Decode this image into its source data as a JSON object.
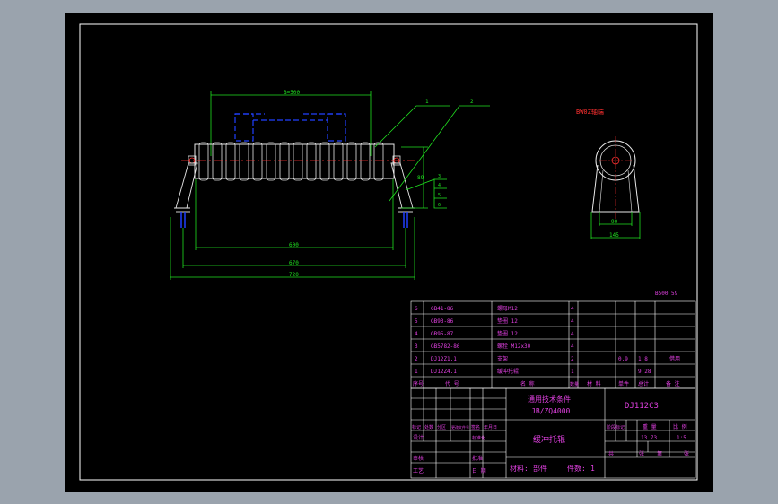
{
  "dimensions": {
    "front_b": "B=500",
    "dim_600": "600",
    "dim_670": "670",
    "dim_720": "720",
    "dim_89": "89",
    "side_90": "90",
    "side_145": "145",
    "side_title": "BW0Z轴端",
    "callout_1": "1",
    "callout_2": "2",
    "tab_3": "3",
    "tab_4": "4",
    "tab_5": "5",
    "tab_6": "6"
  },
  "spec_note": "B500  59",
  "parts": [
    {
      "no": "6",
      "code": "GB41-86",
      "name": "螺母M12",
      "qty": "4",
      "w1": "",
      "w2": "",
      "note": ""
    },
    {
      "no": "5",
      "code": "GB93-86",
      "name": "垫圈 12",
      "qty": "4",
      "w1": "",
      "w2": "",
      "note": ""
    },
    {
      "no": "4",
      "code": "GB95-87",
      "name": "垫圈 12",
      "qty": "4",
      "w1": "",
      "w2": "",
      "note": ""
    },
    {
      "no": "3",
      "code": "GB5782-86",
      "name": "螺栓 M12x30",
      "qty": "4",
      "w1": "",
      "w2": "",
      "note": ""
    },
    {
      "no": "2",
      "code": "DJ12Z1.1",
      "name": "支架",
      "qty": "2",
      "w1": "0.9",
      "w2": "1.8",
      "note": "借用"
    },
    {
      "no": "1",
      "code": "DJ12Z4.1",
      "name": "缓冲托辊",
      "qty": "1",
      "w1": "",
      "w2": "9.28",
      "note": ""
    }
  ],
  "parts_header": {
    "no": "序号",
    "code": "代 号",
    "name": "名 称",
    "qty": "数量",
    "material": "材 料",
    "single": "单件",
    "total": "总计",
    "weight": "重 量",
    "note": "备 注"
  },
  "title_block": {
    "standard_line1": "通用技术条件",
    "standard_line2": "JB/ZQ4000",
    "drawing_no": "DJ112C3",
    "drawing_name": "缓冲托辊",
    "material_label": "材料:",
    "material_value": "部件",
    "count_label": "件数:",
    "count_value": "1",
    "stage_label": "阶段标记",
    "weight_label": "重 量",
    "scale_label": "比 例",
    "weight_value": "13.73",
    "scale_value": "1:5",
    "sheet_total": "共",
    "sheet_unit": "张",
    "sheet_no": "第",
    "sheet_unit2": "张",
    "rev_marks": "标记",
    "rev_count": "处数",
    "rev_zone": "分区",
    "rev_doc": "更改文件号",
    "rev_sign": "签名",
    "rev_date": "年月日",
    "design": "设计",
    "check": "审核",
    "process": "工艺",
    "standardize": "标准化",
    "approve": "批准",
    "date_label": "日 期"
  },
  "colors": {
    "frame": "#ffffff",
    "sheet": "#000000",
    "dimension": "#20e020",
    "roller": "#e8e8e8",
    "table_text": "#e040e0",
    "centerline": "#ff3030",
    "hidden": "#2040ff"
  }
}
